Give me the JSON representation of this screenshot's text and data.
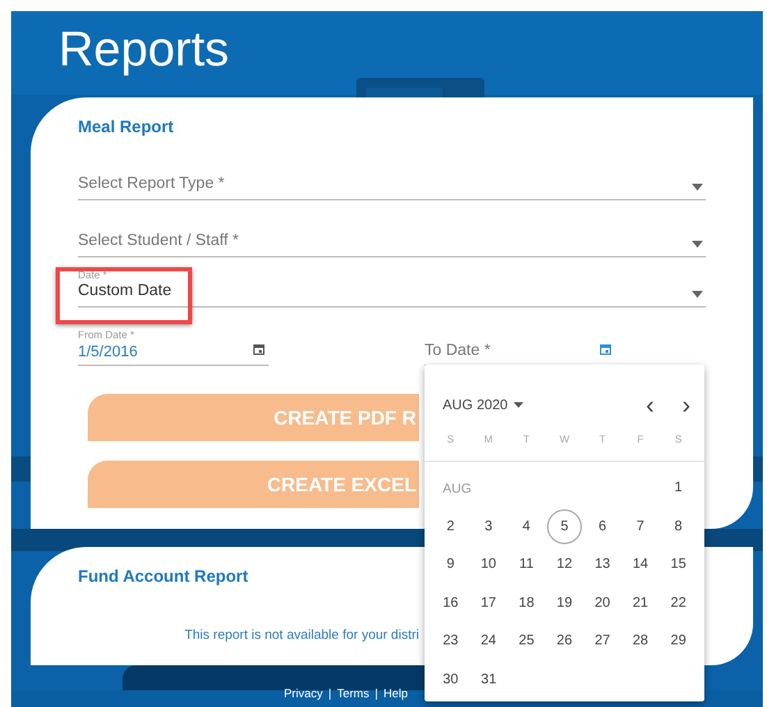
{
  "page": {
    "title": "Reports"
  },
  "meal_report": {
    "title": "Meal Report",
    "fields": [
      {
        "kind": "select",
        "placeholder": "Select Report Type *"
      },
      {
        "kind": "select",
        "placeholder": "Select Student / Staff *"
      },
      {
        "kind": "select",
        "label": "Date *",
        "value": "Custom Date",
        "highlighted": true
      }
    ],
    "date_fields": [
      {
        "label": "From Date *",
        "value": "1/5/2016",
        "focused": false
      },
      {
        "placeholder": "To Date *",
        "focused": true
      }
    ],
    "buttons": [
      "CREATE PDF R",
      "CREATE EXCEL"
    ]
  },
  "fund_account_report": {
    "title": "Fund Account Report",
    "message": "This report is not available for your distri"
  },
  "date_picker": {
    "month_label": "AUG 2020",
    "prev": "‹",
    "next": "›",
    "weekdays": [
      "S",
      "M",
      "T",
      "W",
      "T",
      "F",
      "S"
    ],
    "month_short": "AUG",
    "weeks": [
      [
        {
          "day": "1",
          "today": false
        }
      ],
      [
        {
          "day": "2",
          "today": false
        },
        {
          "day": "3",
          "today": false
        },
        {
          "day": "4",
          "today": false
        },
        {
          "day": "5",
          "today": true
        },
        {
          "day": "6",
          "today": false
        },
        {
          "day": "7",
          "today": false
        },
        {
          "day": "8",
          "today": false
        }
      ],
      [
        {
          "day": "9",
          "today": false
        },
        {
          "day": "10",
          "today": false
        },
        {
          "day": "11",
          "today": false
        },
        {
          "day": "12",
          "today": false
        },
        {
          "day": "13",
          "today": false
        },
        {
          "day": "14",
          "today": false
        },
        {
          "day": "15",
          "today": false
        }
      ],
      [
        {
          "day": "16",
          "today": false
        },
        {
          "day": "17",
          "today": false
        },
        {
          "day": "18",
          "today": false
        },
        {
          "day": "19",
          "today": false
        },
        {
          "day": "20",
          "today": false
        },
        {
          "day": "21",
          "today": false
        },
        {
          "day": "22",
          "today": false
        }
      ],
      [
        {
          "day": "23",
          "today": false
        },
        {
          "day": "24",
          "today": false
        },
        {
          "day": "25",
          "today": false
        },
        {
          "day": "26",
          "today": false
        },
        {
          "day": "27",
          "today": false
        },
        {
          "day": "28",
          "today": false
        },
        {
          "day": "29",
          "today": false
        }
      ],
      [
        {
          "day": "30",
          "today": false
        },
        {
          "day": "31",
          "today": false
        }
      ]
    ]
  },
  "footer": {
    "links": [
      "Privacy",
      "Terms",
      "Help"
    ],
    "separator": "|"
  }
}
